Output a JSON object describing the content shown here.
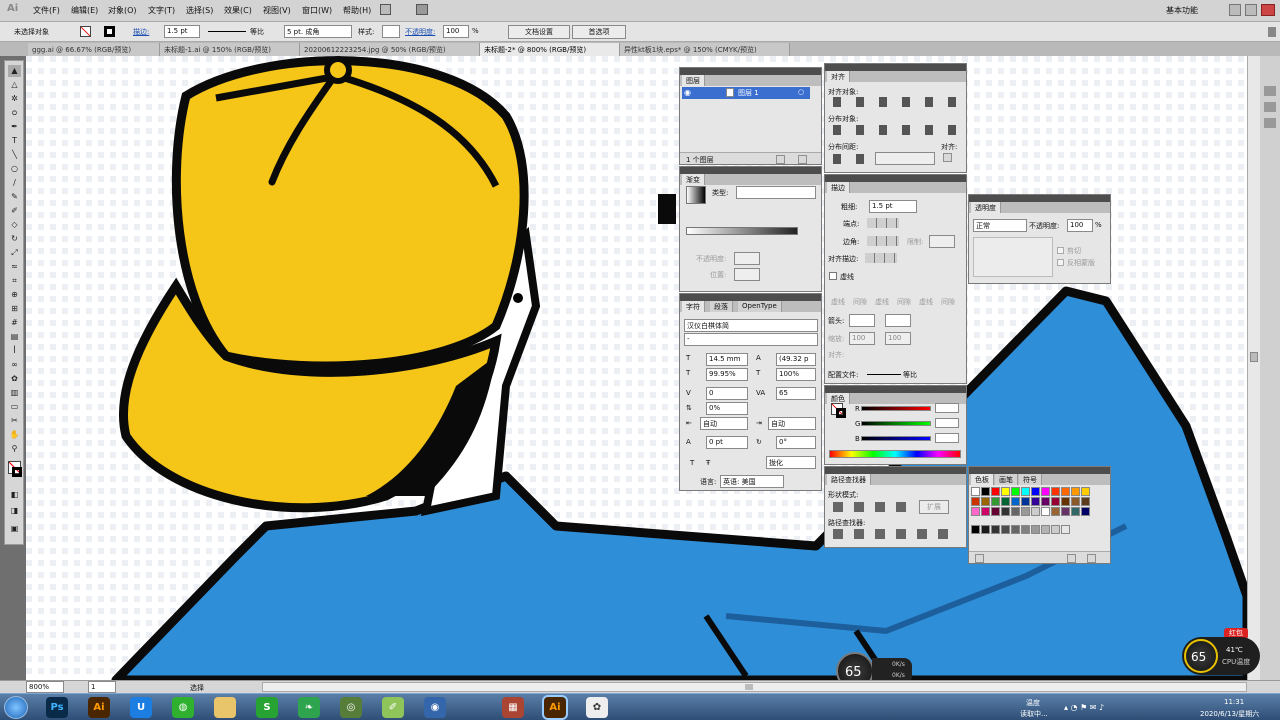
{
  "app": {
    "logo": "Ai",
    "workspace": "基本功能"
  },
  "menu": [
    "文件(F)",
    "编辑(E)",
    "对象(O)",
    "文字(T)",
    "选择(S)",
    "效果(C)",
    "视图(V)",
    "窗口(W)",
    "帮助(H)"
  ],
  "control": {
    "selection": "未选择对象",
    "stroke_label": "描边:",
    "stroke_weight": "1.5 pt",
    "line_style": "等比",
    "brush": "5 pt. 成角",
    "style_label": "样式:",
    "opacity_label": "不透明度:",
    "opacity_value": "100",
    "opacity_unit": "%",
    "doc_setup": "文档设置",
    "prefs": "首选项"
  },
  "tabs": [
    "ggg.ai @ 66.67% (RGB/预览)",
    "未标题-1.ai @ 150% (RGB/预览)",
    "20200612223254.jpg @ 50% (RGB/预览)",
    "未标题-2* @ 800% (RGB/预览)",
    "异性kt板1块.eps* @ 150% (CMYK/预览)"
  ],
  "layers": {
    "tab": "图层",
    "layer_name": "图层 1",
    "footer": "1 个图层"
  },
  "gradient": {
    "tab": "渐变",
    "type_label": "类型:",
    "opacity_label": "不透明度:",
    "position_label": "位置:"
  },
  "align": {
    "tab": "对齐",
    "align_objects": "对齐对象:",
    "distribute_objects": "分布对象:",
    "distribute_spacing": "分布间距:",
    "align_to": "对齐:"
  },
  "stroke": {
    "tab": "描边",
    "weight_label": "粗细:",
    "weight_value": "1.5 pt",
    "cap_label": "端点:",
    "corner_label": "边角:",
    "limit_label": "限制:",
    "align_label": "对齐描边:",
    "dashed_label": "虚线",
    "dash_fields": [
      "虚线",
      "间隙",
      "虚线",
      "间隙",
      "虚线",
      "间隙"
    ],
    "arrow_label": "箭头:",
    "scale_label": "缩放:",
    "scale_values": [
      "100",
      "100"
    ],
    "align_arrow_label": "对齐:",
    "profile_label": "配置文件:",
    "profile_value": "等比"
  },
  "transparency": {
    "tab": "透明度",
    "mode": "正常",
    "opacity_label": "不透明度:",
    "opacity_value": "100",
    "clip": "剪切",
    "invert": "反相蒙版"
  },
  "character": {
    "tabs": [
      "字符",
      "段落",
      "OpenType"
    ],
    "font": "汉仪白棋体简",
    "style": "-",
    "size": "14.5 mm",
    "leading": "(49.32 p",
    "vscale": "99.95%",
    "hscale": "100%",
    "kerning": "0",
    "tracking": "65",
    "tsume": "0%",
    "aki_left": "自动",
    "aki_right": "自动",
    "baseline": "0 pt",
    "rotation": "0°",
    "kinsoku": "拢化",
    "lang_label": "语言:",
    "lang_value": "英语: 美国"
  },
  "color": {
    "tab": "颜色",
    "channels": [
      "R",
      "G",
      "B"
    ]
  },
  "pathfinder": {
    "tab": "路径查找器",
    "shape_modes": "形状模式:",
    "pathfinders": "路径查找器:",
    "expand": "扩展"
  },
  "swatches": {
    "tabs": [
      "色板",
      "画笔",
      "符号"
    ],
    "row1": [
      "#ffffff",
      "#000000",
      "#ff0000",
      "#ffff00",
      "#00ff00",
      "#00ffff",
      "#0000ff",
      "#ff00ff",
      "#ff3300",
      "#ff6600",
      "#ff9900",
      "#ffcc00"
    ],
    "row2": [
      "#cc3300",
      "#996600",
      "#339933",
      "#006633",
      "#0066cc",
      "#003399",
      "#330099",
      "#660066",
      "#990033",
      "#663300",
      "#8b5a2b",
      "#5c3a1e"
    ],
    "row3": [
      "#ff66cc",
      "#cc0066",
      "#660033",
      "#333333",
      "#666666",
      "#999999",
      "#cccccc",
      "#ffffff",
      "#996633",
      "#663366",
      "#336666",
      "#000066"
    ],
    "grays": [
      "#000000",
      "#1a1a1a",
      "#333333",
      "#4d4d4d",
      "#666666",
      "#808080",
      "#999999",
      "#b3b3b3",
      "#cccccc",
      "#e6e6e6"
    ]
  },
  "status": {
    "zoom": "800%",
    "page": "1",
    "tool": "选择"
  },
  "widgets": {
    "net_percent": "65",
    "net_up": "0K/s",
    "net_down": "0K/s",
    "cpu_percent": "65",
    "cpu_temp": "41℃",
    "cpu_label": "CPU温度",
    "badge": "红包"
  },
  "taskbar": {
    "apps": [
      "Ps",
      "Ai",
      "Ai"
    ],
    "tray_text1": "温度",
    "tray_text2": "读取中...",
    "time": "11:31",
    "date": "2020/6/13/星期六"
  },
  "colors": {
    "cap": "#f5c518",
    "shirt": "#2f8ed8",
    "outline": "#0a0a0a",
    "panel_header": "#4d4d4d",
    "highlight": "#3a6fd0"
  }
}
